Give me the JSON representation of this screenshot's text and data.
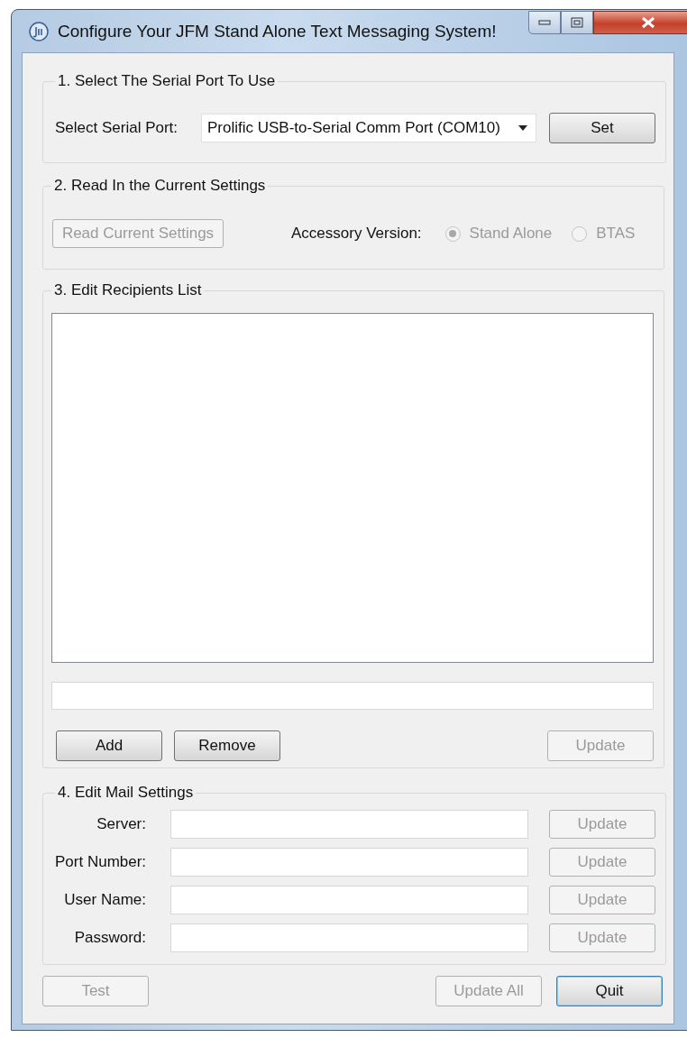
{
  "window": {
    "title": "Configure Your JFM Stand Alone Text Messaging System!"
  },
  "serial_port": {
    "title": "1. Select The Serial Port To Use",
    "label": "Select Serial Port:",
    "value": "Prolific USB-to-Serial Comm Port (COM10)",
    "button": {
      "label": "Set",
      "disabled": false
    }
  },
  "read_settings": {
    "title": "2. Read In the Current Settings",
    "button": {
      "label": "Read Current Settings",
      "disabled": true
    },
    "version_label": "Accessory Version:",
    "options": [
      {
        "label": "Stand Alone",
        "selected": true,
        "disabled": true
      },
      {
        "label": "BTAS",
        "selected": false,
        "disabled": true
      }
    ]
  },
  "recipients": {
    "title": "3. Edit Recipients List",
    "buttons": [
      {
        "label": "Add",
        "disabled": false
      },
      {
        "label": "Remove",
        "disabled": false
      },
      {
        "label": "Update",
        "disabled": true
      }
    ]
  },
  "mail_settings": {
    "title": "4.  Edit Mail Settings",
    "fields": [
      {
        "label": "Server:",
        "button": {
          "label": "Update",
          "disabled": true
        }
      },
      {
        "label": "Port Number:",
        "button": {
          "label": "Update",
          "disabled": true
        }
      },
      {
        "label": "User Name:",
        "button": {
          "label": "Update",
          "disabled": true
        }
      },
      {
        "label": "Password:",
        "button": {
          "label": "Update",
          "disabled": true
        }
      }
    ]
  },
  "footer_buttons": [
    {
      "label": "Test",
      "disabled": true,
      "default": false
    },
    {
      "label": "Update All",
      "disabled": true,
      "default": false
    },
    {
      "label": "Quit",
      "disabled": false,
      "default": true
    }
  ]
}
